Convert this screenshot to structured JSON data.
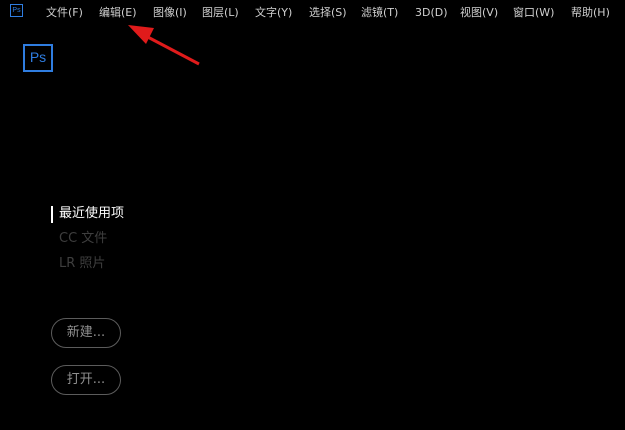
{
  "app_icon_small": "Ps",
  "menubar": {
    "items": [
      {
        "label": "文件(F)"
      },
      {
        "label": "编辑(E)"
      },
      {
        "label": "图像(I)"
      },
      {
        "label": "图层(L)"
      },
      {
        "label": "文字(Y)"
      },
      {
        "label": "选择(S)"
      },
      {
        "label": "滤镜(T)"
      },
      {
        "label": "3D(D)"
      },
      {
        "label": "视图(V)"
      },
      {
        "label": "窗口(W)"
      },
      {
        "label": "帮助(H)"
      }
    ]
  },
  "logo": {
    "label": "Ps"
  },
  "nav": {
    "items": [
      {
        "label": "最近使用项"
      },
      {
        "label": "CC 文件"
      },
      {
        "label": "LR 照片"
      }
    ]
  },
  "buttons": {
    "new_label": "新建...",
    "open_label": "打开..."
  },
  "colors": {
    "background": "#000000",
    "brand_blue": "#2f7de0",
    "annotation_arrow": "#e01b1b"
  }
}
